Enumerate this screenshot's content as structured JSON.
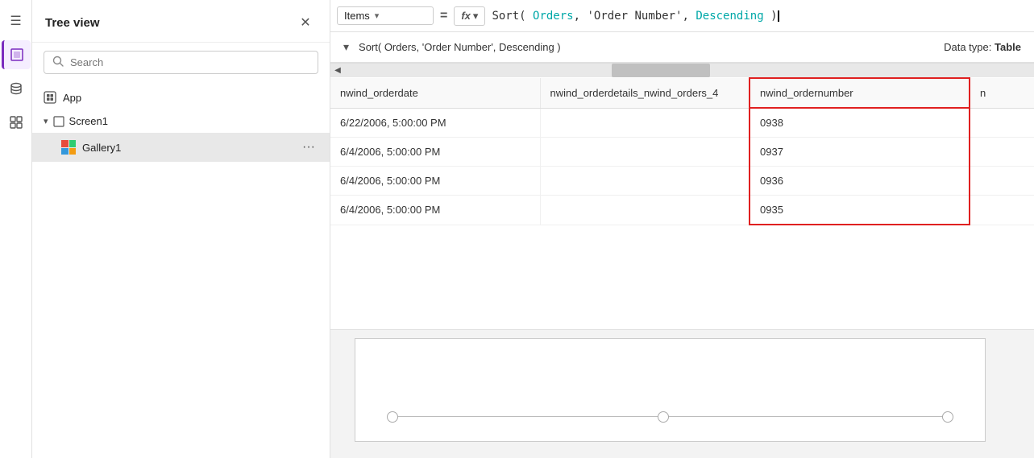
{
  "toolbar": {
    "selector_label": "Items",
    "eq_sign": "=",
    "fx_label": "fx",
    "fx_chevron": "▾",
    "formula": "Sort( Orders, 'Order Number', Descending )"
  },
  "icon_bar": {
    "items": [
      {
        "name": "hamburger-icon",
        "symbol": "☰",
        "active": false
      },
      {
        "name": "layers-icon",
        "symbol": "⧉",
        "active": true
      },
      {
        "name": "database-icon",
        "symbol": "◫",
        "active": false
      },
      {
        "name": "components-icon",
        "symbol": "⊞",
        "active": false
      }
    ]
  },
  "tree_view": {
    "title": "Tree view",
    "search_placeholder": "Search",
    "app_label": "App",
    "screen_label": "Screen1",
    "gallery_label": "Gallery1"
  },
  "preview": {
    "formula_text": "Sort( Orders, 'Order Number', Descending )",
    "datatype_label": "Data type:",
    "datatype_value": "Table"
  },
  "table": {
    "columns": [
      {
        "key": "orderdate",
        "header": "nwind_orderdate"
      },
      {
        "key": "orderdetails",
        "header": "nwind_orderdetails_nwind_orders_4"
      },
      {
        "key": "ordernumber",
        "header": "nwind_ordernumber"
      },
      {
        "key": "extra",
        "header": "n"
      }
    ],
    "rows": [
      {
        "orderdate": "6/22/2006, 5:00:00 PM",
        "orderdetails": "",
        "ordernumber": "0938"
      },
      {
        "orderdate": "6/4/2006, 5:00:00 PM",
        "orderdetails": "",
        "ordernumber": "0937"
      },
      {
        "orderdate": "6/4/2006, 5:00:00 PM",
        "orderdetails": "",
        "ordernumber": "0936"
      },
      {
        "orderdate": "6/4/2006, 5:00:00 PM",
        "orderdetails": "",
        "ordernumber": "0935"
      }
    ]
  },
  "colors": {
    "highlight_col_border": "#e02020",
    "accent": "#7b2cbf"
  }
}
